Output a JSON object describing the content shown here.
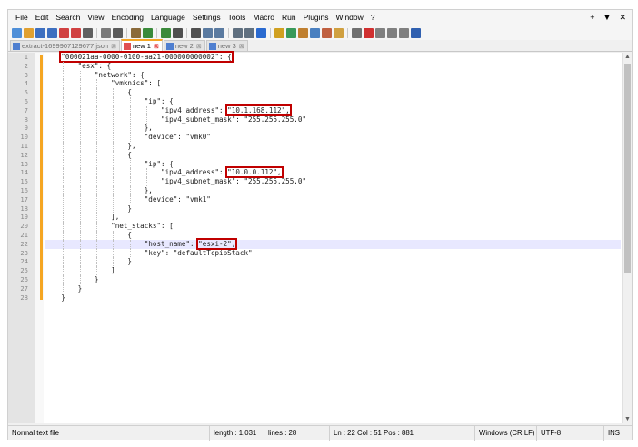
{
  "menubar": {
    "items": [
      "File",
      "Edit",
      "Search",
      "View",
      "Encoding",
      "Language",
      "Settings",
      "Tools",
      "Macro",
      "Run",
      "Plugins",
      "Window",
      "?"
    ],
    "controls": [
      "+",
      "▼",
      "✕"
    ]
  },
  "toolbar": {
    "icons": [
      "new-file",
      "open-file",
      "save",
      "save-all",
      "close",
      "close-all",
      "print",
      "cut",
      "copy",
      "paste",
      "undo",
      "redo",
      "find",
      "replace",
      "zoom-in",
      "zoom-out",
      "sync-vertical",
      "sync-horizontal",
      "word-wrap",
      "show-all-chars",
      "indent-guide",
      "user-language",
      "doc-map",
      "function-list",
      "folder-as-workspace",
      "monitoring",
      "record-macro",
      "stop-macro",
      "play-macro",
      "run-macro-multiple",
      "save-macro"
    ]
  },
  "tabs": [
    {
      "label": "extract-1699907129677.json",
      "active": false
    },
    {
      "label": "new 1",
      "active": true
    },
    {
      "label": "new 2",
      "active": false
    },
    {
      "label": "new 3",
      "active": false
    }
  ],
  "editor": {
    "lines": [
      "    \"000021aa-0000-0100-aa21-000000000002\": {",
      "        \"esx\": {",
      "            \"network\": {",
      "                \"vmknics\": [",
      "                    {",
      "                        \"ip\": {",
      "                            \"ipv4_address\": \"10.1.168.112\",",
      "                            \"ipv4_subnet_mask\": \"255.255.255.0\"",
      "                        },",
      "                        \"device\": \"vmk0\"",
      "                    },",
      "                    {",
      "                        \"ip\": {",
      "                            \"ipv4_address\": \"10.0.0.112\",",
      "                            \"ipv4_subnet_mask\": \"255.255.255.0\"",
      "                        },",
      "                        \"device\": \"vmk1\"",
      "                    }",
      "                ],",
      "                \"net_stacks\": [",
      "                    {",
      "                        \"host_name\": \"esxi-2\",",
      "                        \"key\": \"defaultTcpipStack\"",
      "                    }",
      "                ]",
      "            }",
      "        }",
      "    }"
    ],
    "current_line": 22
  },
  "colors": {
    "highlight_box": "#c00000",
    "active_tab_accent": "#f5a623",
    "current_line_bg": "#e8e8ff"
  },
  "status": {
    "file_type": "Normal text file",
    "length": "length : 1,031",
    "lines": "lines : 28",
    "position": "Ln : 22    Col : 51    Pos : 881",
    "eol": "Windows (CR LF)",
    "encoding": "UTF-8",
    "mode": "INS"
  }
}
